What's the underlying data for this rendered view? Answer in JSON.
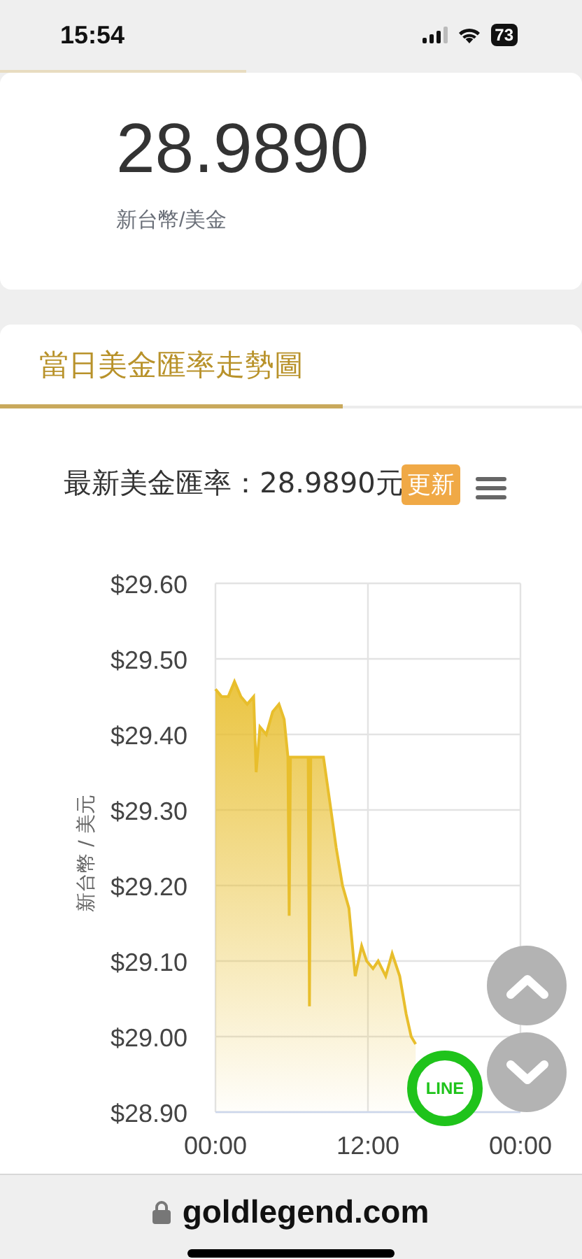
{
  "status_bar": {
    "time": "15:54",
    "battery": "73"
  },
  "rate_card": {
    "value": "28.9890",
    "label": "新台幣/美金"
  },
  "tabs": [
    {
      "label": "當日美金匯率走勢圖",
      "selected": true
    }
  ],
  "chart_panel": {
    "title": "最新美金匯率：28.9890元",
    "update_button": "更新",
    "chart_data": {
      "type": "area",
      "ylabel": "新台幣 / 美元",
      "x": [
        0,
        0.5,
        1,
        1.5,
        2,
        2.5,
        3,
        3.2,
        3.5,
        4,
        4.5,
        5,
        5.4,
        5.7,
        5.8,
        5.9,
        6.5,
        7.3,
        7.4,
        7.5,
        8.5,
        9,
        9.5,
        10,
        10.5,
        11,
        11.5,
        11.9,
        12.4,
        12.8,
        13.4,
        13.9,
        14.5,
        15,
        15.4,
        15.75
      ],
      "series": [
        {
          "color": "#e8be2c",
          "values": [
            29.46,
            29.45,
            29.45,
            29.47,
            29.45,
            29.44,
            29.45,
            29.35,
            29.41,
            29.4,
            29.43,
            29.44,
            29.42,
            29.37,
            29.16,
            29.37,
            29.37,
            29.37,
            29.04,
            29.37,
            29.37,
            29.31,
            29.25,
            29.2,
            29.17,
            29.08,
            29.12,
            29.1,
            29.09,
            29.1,
            29.08,
            29.11,
            29.08,
            29.03,
            29.0,
            28.99
          ]
        }
      ],
      "grid": true,
      "xlim": [
        0,
        24
      ],
      "ylim": [
        28.9,
        29.6
      ],
      "xticks": [
        {
          "value": 0,
          "label": "00:00"
        },
        {
          "value": 12,
          "label": "12:00"
        },
        {
          "value": 24,
          "label": "00:00"
        }
      ],
      "yticks": [
        {
          "value": 28.9,
          "label": "$28.90"
        },
        {
          "value": 29.0,
          "label": "$29.00"
        },
        {
          "value": 29.1,
          "label": "$29.10"
        },
        {
          "value": 29.2,
          "label": "$29.20"
        },
        {
          "value": 29.3,
          "label": "$29.30"
        },
        {
          "value": 29.4,
          "label": "$29.40"
        },
        {
          "value": 29.5,
          "label": "$29.50"
        },
        {
          "value": 29.6,
          "label": "$29.60"
        }
      ]
    }
  },
  "line_button": "LINE",
  "address_bar": {
    "url": "goldlegend.com"
  }
}
